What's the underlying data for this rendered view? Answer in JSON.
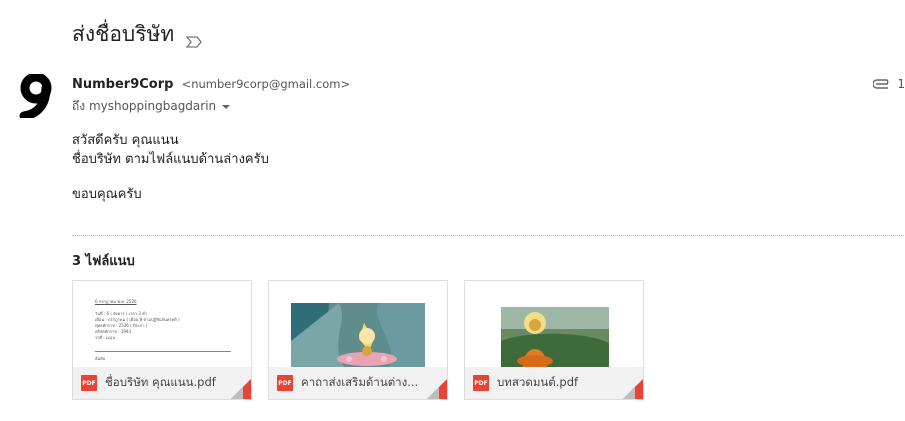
{
  "subject": "ส่งชื่อบริษัท",
  "sender": {
    "name": "Number9Corp",
    "email": "<number9corp@gmail.com>",
    "avatar_text": "9"
  },
  "to": "ถึง myshoppingbagdarin",
  "attachment_count": "1",
  "body": {
    "line1": "สวัสดีครับ คุณแนน",
    "line2": "ชื่อบริษัท ตามไฟล์แนบด้านล่างครับ",
    "line3": "ขอบคุณครับ"
  },
  "attachments_label": "3 ไฟล์แนบ",
  "attachments": [
    {
      "filename": "ชื่อบริษัท คุณแนน.pdf",
      "type": "PDF"
    },
    {
      "filename": "คาถาส่งเสริมด้านต่าง...",
      "type": "PDF"
    },
    {
      "filename": "บทสวดมนต์.pdf",
      "type": "PDF"
    }
  ],
  "doc_preview": {
    "date": "6 กรกฎาคม พ.ศ. 2536",
    "l1": "วันที่ : 6 ( อังคาร ) เวลา 3 ค่ำ",
    "l2": "เดือน : กรกฎาคม ( เดือน 8 ตามปฏิทินจันทรคติ )",
    "l3": "พุทธศักราช : 2536 ( ปีระกา )",
    "l4": "คริสตศักราช : 1993",
    "l5": "ราศี : เมถุน",
    "l6": "อันดับ"
  },
  "colors": {
    "pdf_red": "#e94335",
    "text_dark": "#222222",
    "text_grey": "#555555"
  }
}
